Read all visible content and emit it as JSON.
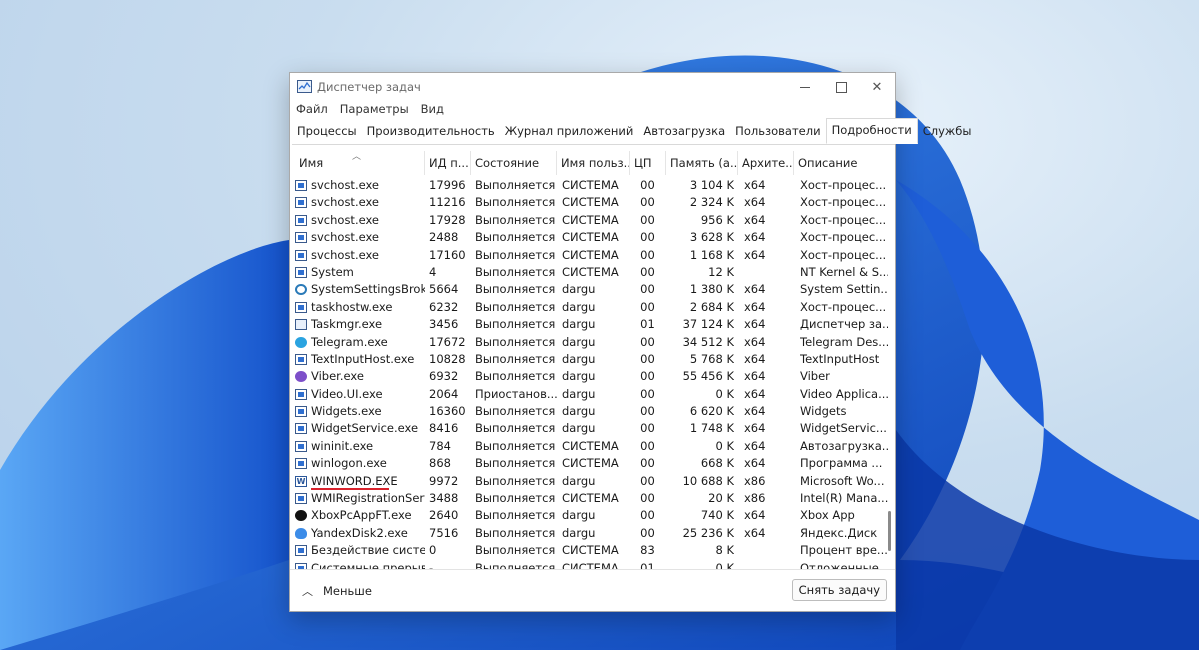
{
  "window": {
    "title": "Диспетчер задач",
    "controls": {
      "minimize": "minimize",
      "maximize": "maximize",
      "close": "✕"
    }
  },
  "menu": [
    "Файл",
    "Параметры",
    "Вид"
  ],
  "tabs": [
    "Процессы",
    "Производительность",
    "Журнал приложений",
    "Автозагрузка",
    "Пользователи",
    "Подробности",
    "Службы"
  ],
  "active_tab": "Подробности",
  "columns": [
    "Имя",
    "ИД п...",
    "Состояние",
    "Имя польз...",
    "ЦП",
    "Память (а...",
    "Архите...",
    "Описание"
  ],
  "rows": [
    {
      "icon": "service-icon",
      "name": "svchost.exe",
      "pid": "17996",
      "state": "Выполняется",
      "user": "СИСТЕМА",
      "cpu": "00",
      "mem": "3 104 K",
      "arch": "x64",
      "desc": "Хост-процес..."
    },
    {
      "icon": "service-icon",
      "name": "svchost.exe",
      "pid": "11216",
      "state": "Выполняется",
      "user": "СИСТЕМА",
      "cpu": "00",
      "mem": "2 324 K",
      "arch": "x64",
      "desc": "Хост-процес..."
    },
    {
      "icon": "service-icon",
      "name": "svchost.exe",
      "pid": "17928",
      "state": "Выполняется",
      "user": "СИСТЕМА",
      "cpu": "00",
      "mem": "956 K",
      "arch": "x64",
      "desc": "Хост-процес..."
    },
    {
      "icon": "service-icon",
      "name": "svchost.exe",
      "pid": "2488",
      "state": "Выполняется",
      "user": "СИСТЕМА",
      "cpu": "00",
      "mem": "3 628 K",
      "arch": "x64",
      "desc": "Хост-процес..."
    },
    {
      "icon": "service-icon",
      "name": "svchost.exe",
      "pid": "17160",
      "state": "Выполняется",
      "user": "СИСТЕМА",
      "cpu": "00",
      "mem": "1 168 K",
      "arch": "x64",
      "desc": "Хост-процес..."
    },
    {
      "icon": "service-icon",
      "name": "System",
      "pid": "4",
      "state": "Выполняется",
      "user": "СИСТЕМА",
      "cpu": "00",
      "mem": "12 K",
      "arch": "",
      "desc": "NT Kernel & S..."
    },
    {
      "icon": "gear-icon",
      "name": "SystemSettingsBroke...",
      "pid": "5664",
      "state": "Выполняется",
      "user": "dargu",
      "cpu": "00",
      "mem": "1 380 K",
      "arch": "x64",
      "desc": "System Settin..."
    },
    {
      "icon": "service-icon",
      "name": "taskhostw.exe",
      "pid": "6232",
      "state": "Выполняется",
      "user": "dargu",
      "cpu": "00",
      "mem": "2 684 K",
      "arch": "x64",
      "desc": "Хост-процес..."
    },
    {
      "icon": "taskmgr-icon",
      "name": "Taskmgr.exe",
      "pid": "3456",
      "state": "Выполняется",
      "user": "dargu",
      "cpu": "01",
      "mem": "37 124 K",
      "arch": "x64",
      "desc": "Диспетчер за..."
    },
    {
      "icon": "telegram-icon",
      "name": "Telegram.exe",
      "pid": "17672",
      "state": "Выполняется",
      "user": "dargu",
      "cpu": "00",
      "mem": "34 512 K",
      "arch": "x64",
      "desc": "Telegram Des..."
    },
    {
      "icon": "service-icon",
      "name": "TextInputHost.exe",
      "pid": "10828",
      "state": "Выполняется",
      "user": "dargu",
      "cpu": "00",
      "mem": "5 768 K",
      "arch": "x64",
      "desc": "TextInputHost"
    },
    {
      "icon": "viber-icon",
      "name": "Viber.exe",
      "pid": "6932",
      "state": "Выполняется",
      "user": "dargu",
      "cpu": "00",
      "mem": "55 456 K",
      "arch": "x64",
      "desc": "Viber"
    },
    {
      "icon": "service-icon",
      "name": "Video.UI.exe",
      "pid": "2064",
      "state": "Приостанов...",
      "user": "dargu",
      "cpu": "00",
      "mem": "0 K",
      "arch": "x64",
      "desc": "Video Applica..."
    },
    {
      "icon": "service-icon",
      "name": "Widgets.exe",
      "pid": "16360",
      "state": "Выполняется",
      "user": "dargu",
      "cpu": "00",
      "mem": "6 620 K",
      "arch": "x64",
      "desc": "Widgets"
    },
    {
      "icon": "service-icon",
      "name": "WidgetService.exe",
      "pid": "8416",
      "state": "Выполняется",
      "user": "dargu",
      "cpu": "00",
      "mem": "1 748 K",
      "arch": "x64",
      "desc": "WidgetServic..."
    },
    {
      "icon": "service-icon",
      "name": "wininit.exe",
      "pid": "784",
      "state": "Выполняется",
      "user": "СИСТЕМА",
      "cpu": "00",
      "mem": "0 K",
      "arch": "x64",
      "desc": "Автозагрузка..."
    },
    {
      "icon": "service-icon",
      "name": "winlogon.exe",
      "pid": "868",
      "state": "Выполняется",
      "user": "СИСТЕМА",
      "cpu": "00",
      "mem": "668 K",
      "arch": "x64",
      "desc": "Программа ..."
    },
    {
      "icon": "word-icon",
      "name": "WINWORD.EXE",
      "pid": "9972",
      "state": "Выполняется",
      "user": "dargu",
      "cpu": "00",
      "mem": "10 688 K",
      "arch": "x86",
      "desc": "Microsoft Wo...",
      "highlight": true
    },
    {
      "icon": "service-icon",
      "name": "WMIRegistrationServ...",
      "pid": "3488",
      "state": "Выполняется",
      "user": "СИСТЕМА",
      "cpu": "00",
      "mem": "20 K",
      "arch": "x86",
      "desc": "Intel(R) Mana..."
    },
    {
      "icon": "xbox-icon",
      "name": "XboxPcAppFT.exe",
      "pid": "2640",
      "state": "Выполняется",
      "user": "dargu",
      "cpu": "00",
      "mem": "740 K",
      "arch": "x64",
      "desc": "Xbox App"
    },
    {
      "icon": "yandex-disk-icon",
      "name": "YandexDisk2.exe",
      "pid": "7516",
      "state": "Выполняется",
      "user": "dargu",
      "cpu": "00",
      "mem": "25 236 K",
      "arch": "x64",
      "desc": "Яндекс.Диск"
    },
    {
      "icon": "service-icon",
      "name": "Бездействие системы",
      "pid": "0",
      "state": "Выполняется",
      "user": "СИСТЕМА",
      "cpu": "83",
      "mem": "8 K",
      "arch": "",
      "desc": "Процент вре..."
    },
    {
      "icon": "service-icon",
      "name": "Системные прерыв...",
      "pid": "-",
      "state": "Выполняется",
      "user": "СИСТЕМА",
      "cpu": "01",
      "mem": "0 K",
      "arch": "",
      "desc": "Отложенные ..."
    }
  ],
  "footer": {
    "less_label": "Меньше",
    "end_task_label": "Снять задачу"
  }
}
